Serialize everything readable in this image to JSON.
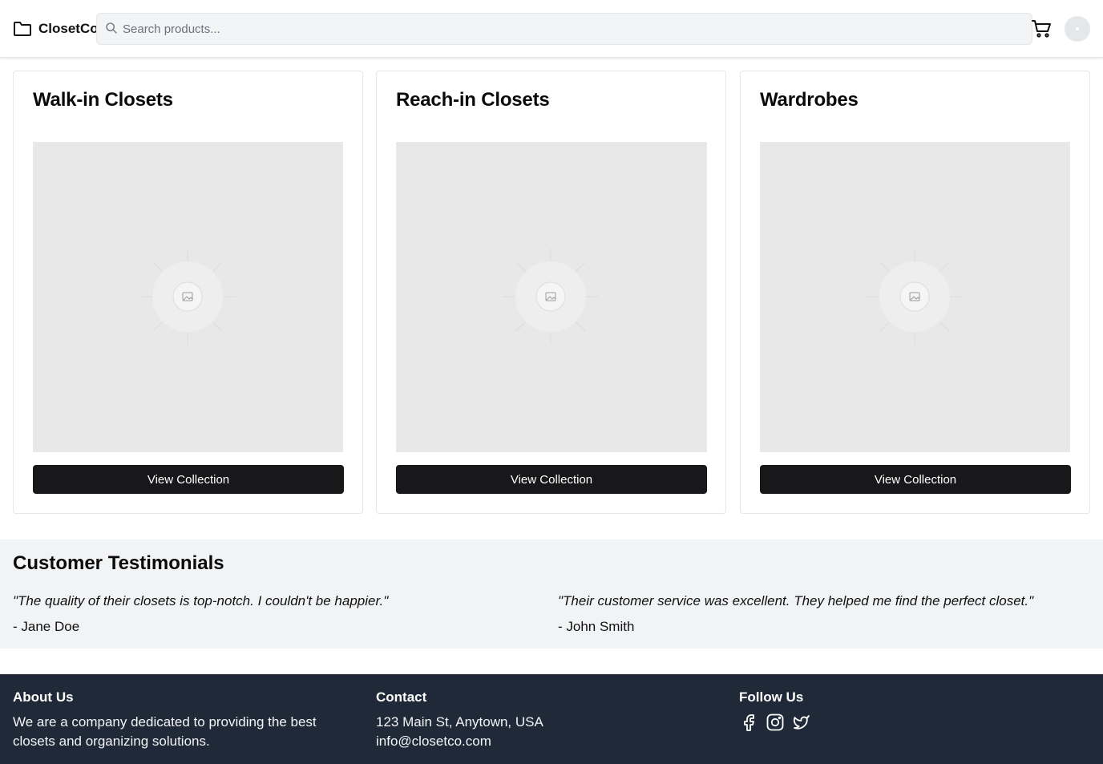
{
  "header": {
    "brand": "ClosetCo",
    "search_placeholder": "Search products..."
  },
  "collections": [
    {
      "title": "Walk-in Closets",
      "button": "View Collection"
    },
    {
      "title": "Reach-in Closets",
      "button": "View Collection"
    },
    {
      "title": "Wardrobes",
      "button": "View Collection"
    }
  ],
  "testimonials": {
    "title": "Customer Testimonials",
    "items": [
      {
        "quote": "\"The quality of their closets is top-notch. I couldn't be happier.\"",
        "author": "- Jane Doe"
      },
      {
        "quote": "\"Their customer service was excellent. They helped me find the perfect closet.\"",
        "author": "- John Smith"
      }
    ]
  },
  "footer": {
    "about": {
      "heading": "About Us",
      "line1": "We are a company dedicated to providing the best",
      "line2": "closets and organizing solutions."
    },
    "contact": {
      "heading": "Contact",
      "address": "123 Main St, Anytown, USA",
      "email": "info@closetco.com"
    },
    "follow": {
      "heading": "Follow Us",
      "icons": [
        "facebook-icon",
        "instagram-icon",
        "twitter-icon"
      ]
    }
  },
  "colors": {
    "button_bg": "#18181b",
    "footer_bg": "#1f2937",
    "testimonials_bg": "#f1f3f5"
  }
}
